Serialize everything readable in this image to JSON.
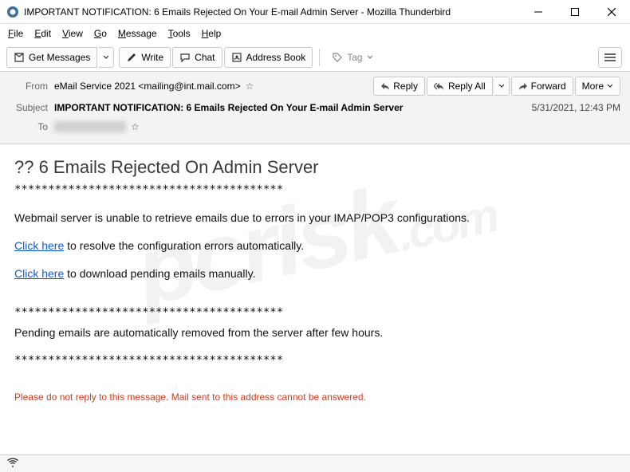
{
  "window": {
    "title": "IMPORTANT NOTIFICATION: 6 Emails Rejected On Your E-mail Admin Server - Mozilla Thunderbird"
  },
  "menubar": {
    "file": "File",
    "edit": "Edit",
    "view": "View",
    "go": "Go",
    "message": "Message",
    "tools": "Tools",
    "help": "Help"
  },
  "toolbar": {
    "get_messages": "Get Messages",
    "write": "Write",
    "chat": "Chat",
    "address_book": "Address Book",
    "tag": "Tag"
  },
  "header": {
    "from_label": "From",
    "from_value": "eMail Service 2021 <mailing@int.mail.com>",
    "subject_label": "Subject",
    "subject_value": "IMPORTANT NOTIFICATION: 6 Emails Rejected On Your E-mail Admin Server",
    "to_label": "To",
    "date": "5/31/2021, 12:43 PM",
    "actions": {
      "reply": "Reply",
      "reply_all": "Reply All",
      "forward": "Forward",
      "more": "More"
    }
  },
  "body": {
    "heading": "?? 6 Emails Rejected On Admin Server",
    "sep": "****************************************",
    "p1": "Webmail server is unable to retrieve emails due to errors in your IMAP/POP3 configurations.",
    "link1": "Click here",
    "link1_rest": "  to resolve the configuration errors automatically.",
    "link2": "Click here",
    "link2_rest": "  to download pending emails manually.",
    "p2": "Pending emails are automatically removed from the server after few hours.",
    "warn": "Please do not reply to this message. Mail sent to this address cannot be answered."
  },
  "watermark": {
    "main": "pcrisk",
    "ext": ".com"
  }
}
